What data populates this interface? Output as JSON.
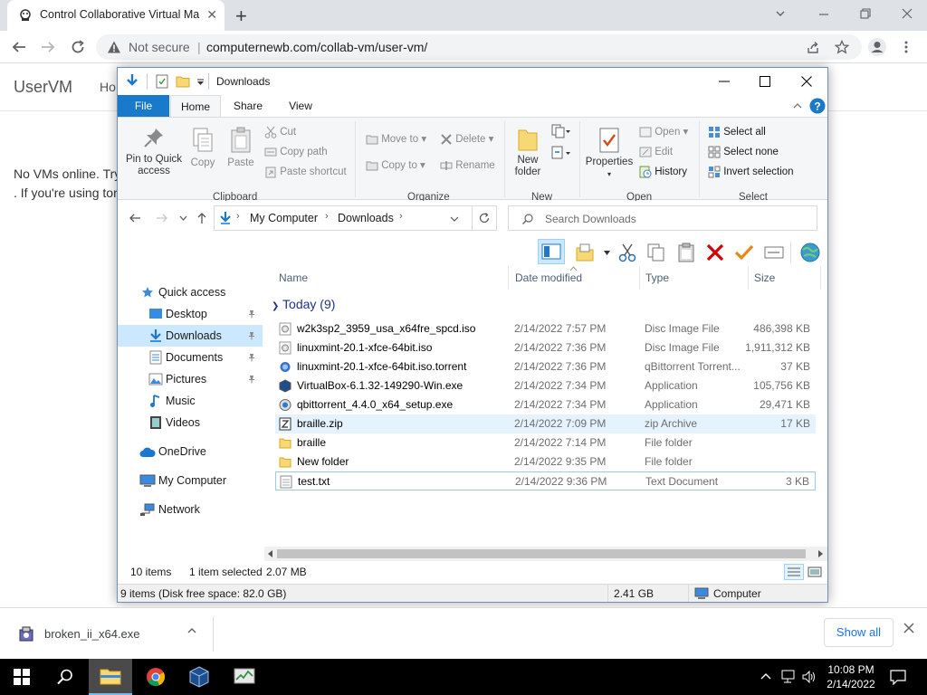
{
  "browser": {
    "tab_title": "Control Collaborative Virtual Ma",
    "tab_close": "✕",
    "new_tab": "+",
    "not_secure": "Not secure",
    "url": "computernewb.com/collab-vm/user-vm/",
    "url_sep": "|"
  },
  "page": {
    "brand": "UserVM",
    "nav_home": "Ho",
    "message_line1": "No VMs online. Try",
    "message_line2": ". If you're using tor"
  },
  "explorer": {
    "title": "Downloads",
    "ribbon_tabs": {
      "file": "File",
      "home": "Home",
      "share": "Share",
      "view": "View"
    },
    "clipboard": {
      "pin_line1": "Pin to Quick",
      "pin_line2": "access",
      "copy": "Copy",
      "paste": "Paste",
      "cut": "Cut",
      "copy_path": "Copy path",
      "paste_shortcut": "Paste shortcut",
      "group": "Clipboard"
    },
    "organize": {
      "move_to": "Move to",
      "copy_to": "Copy to",
      "delete": "Delete",
      "rename": "Rename",
      "group": "Organize"
    },
    "new": {
      "new_folder_line1": "New",
      "new_folder_line2": "folder",
      "group": "New"
    },
    "open": {
      "properties": "Properties",
      "open": "Open",
      "edit": "Edit",
      "history": "History",
      "group": "Open"
    },
    "select": {
      "select_all": "Select all",
      "select_none": "Select none",
      "invert": "Invert selection",
      "group": "Select"
    },
    "address": {
      "root": "My Computer",
      "current": "Downloads"
    },
    "search_placeholder": "Search Downloads",
    "nav": {
      "quick_access": "Quick access",
      "desktop": "Desktop",
      "downloads": "Downloads",
      "documents": "Documents",
      "pictures": "Pictures",
      "music": "Music",
      "videos": "Videos",
      "onedrive": "OneDrive",
      "my_computer": "My Computer",
      "network": "Network"
    },
    "columns": {
      "name": "Name",
      "date": "Date modified",
      "type": "Type",
      "size": "Size"
    },
    "group_header": "Today (9)",
    "files": [
      {
        "name": "w2k3sp2_3959_usa_x64fre_spcd.iso",
        "date": "2/14/2022 7:57 PM",
        "type": "Disc Image File",
        "size": "486,398 KB"
      },
      {
        "name": "linuxmint-20.1-xfce-64bit.iso",
        "date": "2/14/2022 7:36 PM",
        "type": "Disc Image File",
        "size": "1,911,312 KB"
      },
      {
        "name": "linuxmint-20.1-xfce-64bit.iso.torrent",
        "date": "2/14/2022 7:36 PM",
        "type": "qBittorrent Torrent...",
        "size": "37 KB"
      },
      {
        "name": "VirtualBox-6.1.32-149290-Win.exe",
        "date": "2/14/2022 7:34 PM",
        "type": "Application",
        "size": "105,756 KB"
      },
      {
        "name": "qbittorrent_4.4.0_x64_setup.exe",
        "date": "2/14/2022 7:34 PM",
        "type": "Application",
        "size": "29,471 KB"
      },
      {
        "name": "braille.zip",
        "date": "2/14/2022 7:09 PM",
        "type": "zip Archive",
        "size": "17 KB"
      },
      {
        "name": "braille",
        "date": "2/14/2022 7:14 PM",
        "type": "File folder",
        "size": ""
      },
      {
        "name": "New folder",
        "date": "2/14/2022 9:35 PM",
        "type": "File folder",
        "size": ""
      },
      {
        "name": "test.txt",
        "date": "2/14/2022 9:36 PM",
        "type": "Text Document",
        "size": "3 KB"
      }
    ],
    "status": {
      "items": "10 items",
      "selected": "1 item selected",
      "sel_size": "2.07 MB"
    },
    "status2": {
      "disk": "9 items (Disk free space: 82.0 GB)",
      "size": "2.41 GB",
      "location": "Computer"
    }
  },
  "downloads_bar": {
    "file": "broken_ii_x64.exe",
    "show_all": "Show all"
  },
  "taskbar": {
    "time": "10:08 PM",
    "date": "2/14/2022"
  },
  "colors": {
    "accent": "#1979ca",
    "selection": "#cce8ff",
    "delete_red": "#d40000",
    "check_orange": "#e8891a"
  }
}
